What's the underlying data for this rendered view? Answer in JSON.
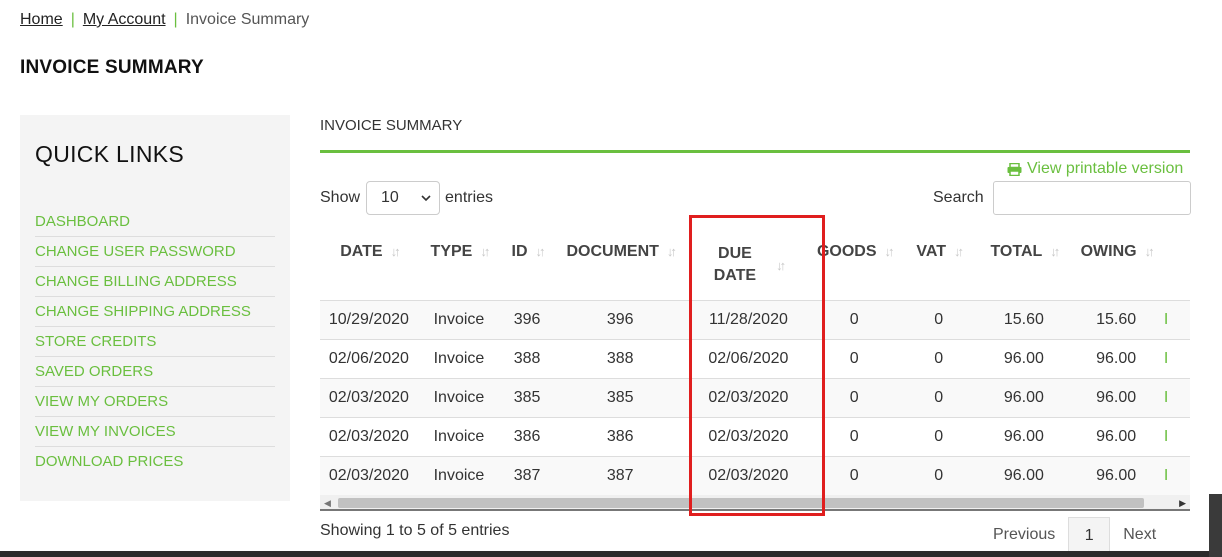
{
  "breadcrumb": {
    "home": "Home",
    "account": "My Account",
    "current": "Invoice Summary",
    "separator": "|"
  },
  "page_title": "INVOICE SUMMARY",
  "sidebar": {
    "title": "QUICK LINKS",
    "items": [
      {
        "label": "DASHBOARD"
      },
      {
        "label": "CHANGE USER PASSWORD"
      },
      {
        "label": "CHANGE BILLING ADDRESS"
      },
      {
        "label": "CHANGE SHIPPING ADDRESS"
      },
      {
        "label": "STORE CREDITS"
      },
      {
        "label": "SAVED ORDERS"
      },
      {
        "label": "VIEW MY ORDERS"
      },
      {
        "label": "VIEW MY INVOICES"
      },
      {
        "label": "DOWNLOAD PRICES"
      }
    ]
  },
  "main": {
    "section_title": "INVOICE SUMMARY",
    "printable_label": "View printable version",
    "show_label": "Show",
    "entries_value": "10",
    "entries_label": "entries",
    "search_label": "Search",
    "search_value": ""
  },
  "table": {
    "columns": [
      {
        "line1": "DATE",
        "line2": ""
      },
      {
        "line1": "TYPE",
        "line2": ""
      },
      {
        "line1": "ID",
        "line2": ""
      },
      {
        "line1": "DOCUMENT",
        "line2": ""
      },
      {
        "line1": "DUE",
        "line2": "DATE"
      },
      {
        "line1": "GOODS",
        "line2": ""
      },
      {
        "line1": "VAT",
        "line2": ""
      },
      {
        "line1": "TOTAL",
        "line2": ""
      },
      {
        "line1": "OWING",
        "line2": ""
      }
    ],
    "rows": [
      {
        "date": "10/29/2020",
        "type": "Invoice",
        "id": "396",
        "document": "396",
        "due": "11/28/2020",
        "goods": "0",
        "vat": "0",
        "total": "15.60",
        "owing": "15.60",
        "more": "I"
      },
      {
        "date": "02/06/2020",
        "type": "Invoice",
        "id": "388",
        "document": "388",
        "due": "02/06/2020",
        "goods": "0",
        "vat": "0",
        "total": "96.00",
        "owing": "96.00",
        "more": "I"
      },
      {
        "date": "02/03/2020",
        "type": "Invoice",
        "id": "385",
        "document": "385",
        "due": "02/03/2020",
        "goods": "0",
        "vat": "0",
        "total": "96.00",
        "owing": "96.00",
        "more": "I"
      },
      {
        "date": "02/03/2020",
        "type": "Invoice",
        "id": "386",
        "document": "386",
        "due": "02/03/2020",
        "goods": "0",
        "vat": "0",
        "total": "96.00",
        "owing": "96.00",
        "more": "I"
      },
      {
        "date": "02/03/2020",
        "type": "Invoice",
        "id": "387",
        "document": "387",
        "due": "02/03/2020",
        "goods": "0",
        "vat": "0",
        "total": "96.00",
        "owing": "96.00",
        "more": "I"
      }
    ]
  },
  "footer": {
    "info": "Showing 1 to 5 of 5 entries",
    "previous": "Previous",
    "page": "1",
    "next": "Next"
  },
  "colors": {
    "accent": "#6abf3f",
    "highlight": "#e01e1e"
  }
}
